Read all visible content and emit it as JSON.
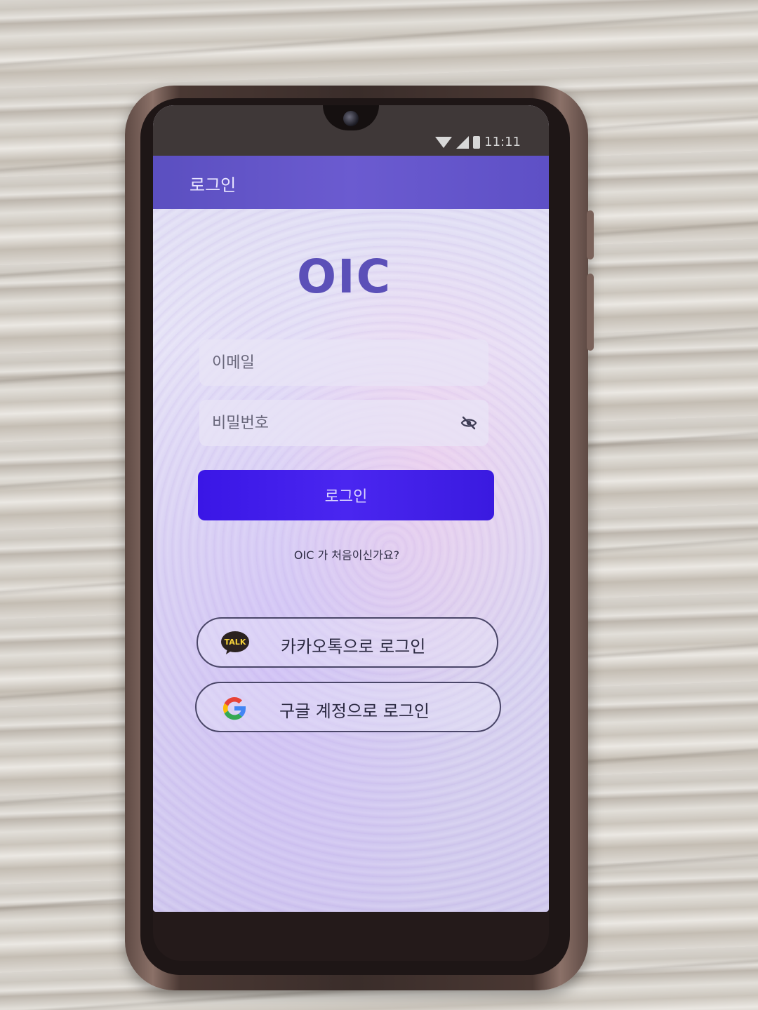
{
  "status_bar": {
    "time": "11:11",
    "icons": [
      "wifi-icon",
      "signal-icon",
      "battery-icon"
    ]
  },
  "app_bar": {
    "title": "로그인"
  },
  "logo": {
    "text": "OIC",
    "color": "#5b50b8"
  },
  "form": {
    "email_placeholder": "이메일",
    "password_placeholder": "비밀번호",
    "password_toggle_icon": "eye-off-icon",
    "login_label": "로그인",
    "accent": "#3a16e6"
  },
  "signup_prompt": "OIC 가 처음이신가요?",
  "social": {
    "kakao": {
      "label": "카카오톡으로 로그인",
      "icon": "kakao-talk-icon",
      "icon_text": "TALK"
    },
    "google": {
      "label": "구글 계정으로 로그인",
      "icon": "google-g-icon"
    }
  }
}
